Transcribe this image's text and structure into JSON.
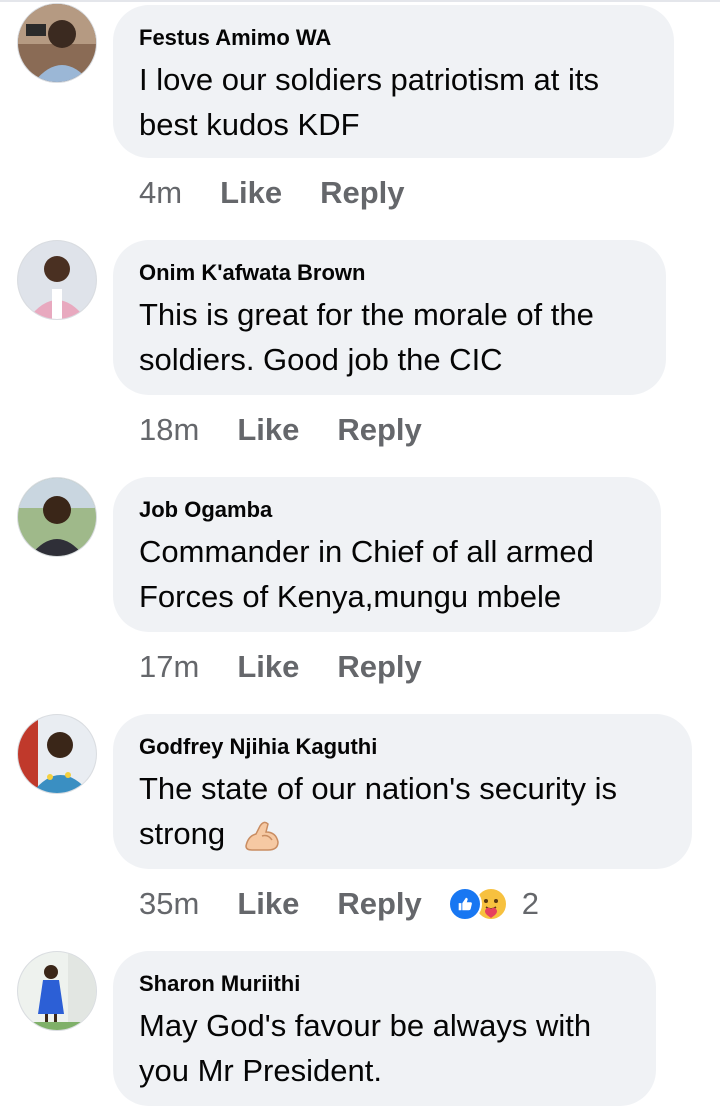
{
  "comments": [
    {
      "author": "Festus Amimo WA",
      "line1": "I love our soldiers patriotism at its",
      "line2": "best kudos KDF",
      "time": "4m",
      "like": "Like",
      "reply": "Reply"
    },
    {
      "author": "Onim K'afwata Brown",
      "line1": "This is great for the morale of the",
      "line2": "soldiers. Good job the CIC",
      "time": "18m",
      "like": "Like",
      "reply": "Reply"
    },
    {
      "author": "Job Ogamba",
      "line1": "Commander in Chief of all armed",
      "line2": "Forces of Kenya,mungu mbele",
      "time": "17m",
      "like": "Like",
      "reply": "Reply"
    },
    {
      "author": "Godfrey Njihia Kaguthi",
      "line1": "The state of our nation's security is",
      "line2": "strong",
      "line2_emoji": "flexed-biceps-emoji",
      "time": "35m",
      "like": "Like",
      "reply": "Reply",
      "reactions": {
        "icons": [
          "like-reaction-icon",
          "care-reaction-icon"
        ],
        "count": "2"
      }
    },
    {
      "author": "Sharon Muriithi",
      "line1": "May God's favour be always with",
      "line2": "you Mr President.",
      "time": "",
      "like": "",
      "reply": ""
    }
  ],
  "colors": {
    "bubble": "#f0f2f5",
    "secondary_text": "#65676b",
    "like_blue": "#1877f2"
  }
}
